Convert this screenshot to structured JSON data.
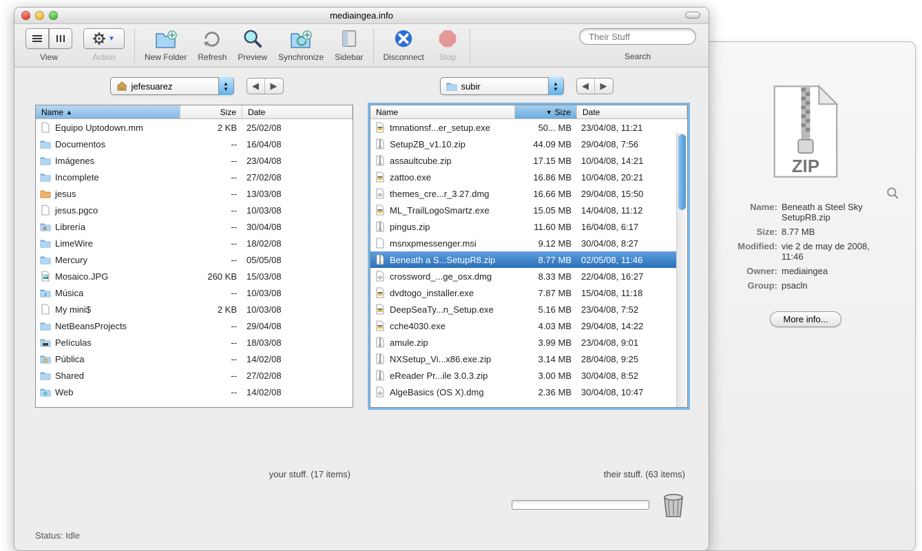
{
  "window": {
    "title": "mediaingea.info"
  },
  "toolbar": {
    "view_label": "View",
    "action_label": "Action",
    "new_folder": "New Folder",
    "refresh": "Refresh",
    "preview": "Preview",
    "synchronize": "Synchronize",
    "sidebar": "Sidebar",
    "disconnect": "Disconnect",
    "stop": "Stop",
    "search_label": "Search",
    "search_placeholder": "Their Stuff"
  },
  "path": {
    "left": "jefesuarez",
    "right": "subir"
  },
  "columns": {
    "name": "Name",
    "size": "Size",
    "date": "Date"
  },
  "left": {
    "label": "your stuff. (17 items)",
    "items": [
      {
        "icon": "doc",
        "name": "Equipo Uptodown.mm",
        "size": "2 KB",
        "date": "25/02/08"
      },
      {
        "icon": "folder",
        "name": "Documentos",
        "size": "--",
        "date": "16/04/08"
      },
      {
        "icon": "folder",
        "name": "Imágenes",
        "size": "--",
        "date": "23/04/08"
      },
      {
        "icon": "folder",
        "name": "Incomplete",
        "size": "--",
        "date": "27/02/08"
      },
      {
        "icon": "folder-orange",
        "name": "jesus",
        "size": "--",
        "date": "13/03/08"
      },
      {
        "icon": "doc",
        "name": "jesus.pgco",
        "size": "--",
        "date": "10/03/08"
      },
      {
        "icon": "folder-books",
        "name": "Librería",
        "size": "--",
        "date": "30/04/08"
      },
      {
        "icon": "folder",
        "name": "LimeWire",
        "size": "--",
        "date": "18/02/08"
      },
      {
        "icon": "folder",
        "name": "Mercury",
        "size": "--",
        "date": "05/05/08"
      },
      {
        "icon": "image",
        "name": "Mosaico.JPG",
        "size": "260 KB",
        "date": "15/03/08"
      },
      {
        "icon": "folder-music",
        "name": "Música",
        "size": "--",
        "date": "10/03/08"
      },
      {
        "icon": "doc",
        "name": "My mini$",
        "size": "2 KB",
        "date": "10/03/08"
      },
      {
        "icon": "folder",
        "name": "NetBeansProjects",
        "size": "--",
        "date": "29/04/08"
      },
      {
        "icon": "folder-movie",
        "name": "Películas",
        "size": "--",
        "date": "18/03/08"
      },
      {
        "icon": "folder-public",
        "name": "Pública",
        "size": "--",
        "date": "14/02/08"
      },
      {
        "icon": "folder",
        "name": "Shared",
        "size": "--",
        "date": "27/02/08"
      },
      {
        "icon": "folder-web",
        "name": "Web",
        "size": "--",
        "date": "14/02/08"
      }
    ]
  },
  "right": {
    "label": "their stuff. (63 items)",
    "selected_index": 8,
    "items": [
      {
        "icon": "exe",
        "name": "tmnationsf...er_setup.exe",
        "size": "50... MB",
        "date": "23/04/08, 11:21"
      },
      {
        "icon": "zip",
        "name": "SetupZB_v1.10.zip",
        "size": "44.09 MB",
        "date": "29/04/08, 7:56"
      },
      {
        "icon": "zip",
        "name": "assaultcube.zip",
        "size": "17.15 MB",
        "date": "10/04/08, 14:21"
      },
      {
        "icon": "exe",
        "name": "zattoo.exe",
        "size": "16.86 MB",
        "date": "10/04/08, 20:21"
      },
      {
        "icon": "dmg",
        "name": "themes_cre...r_3.27.dmg",
        "size": "16.66 MB",
        "date": "29/04/08, 15:50"
      },
      {
        "icon": "exe",
        "name": "ML_TrailLogoSmartz.exe",
        "size": "15.05 MB",
        "date": "14/04/08, 11:12"
      },
      {
        "icon": "zip",
        "name": "pingus.zip",
        "size": "11.60 MB",
        "date": "16/04/08, 6:17"
      },
      {
        "icon": "doc",
        "name": "msnxpmessenger.msi",
        "size": "9.12 MB",
        "date": "30/04/08, 8:27"
      },
      {
        "icon": "zip",
        "name": "Beneath a S...SetupR8.zip",
        "size": "8.77 MB",
        "date": "02/05/08, 11:46"
      },
      {
        "icon": "dmg",
        "name": "crossword_...ge_osx.dmg",
        "size": "8.33 MB",
        "date": "22/04/08, 16:27"
      },
      {
        "icon": "exe",
        "name": "dvdtogo_installer.exe",
        "size": "7.87 MB",
        "date": "15/04/08, 11:18"
      },
      {
        "icon": "exe",
        "name": "DeepSeaTy...n_Setup.exe",
        "size": "5.16 MB",
        "date": "23/04/08, 7:52"
      },
      {
        "icon": "exe",
        "name": "cche4030.exe",
        "size": "4.03 MB",
        "date": "29/04/08, 14:22"
      },
      {
        "icon": "zip",
        "name": "amule.zip",
        "size": "3.99 MB",
        "date": "23/04/08, 9:01"
      },
      {
        "icon": "zip",
        "name": "NXSetup_Vi...x86.exe.zip",
        "size": "3.14 MB",
        "date": "28/04/08, 9:25"
      },
      {
        "icon": "zip",
        "name": "eReader Pr...ile 3.0.3.zip",
        "size": "3.00 MB",
        "date": "30/04/08, 8:52"
      },
      {
        "icon": "dmg",
        "name": "AlgeBasics (OS X).dmg",
        "size": "2.36 MB",
        "date": "30/04/08, 10:47"
      }
    ]
  },
  "info": {
    "icon_label": "ZIP",
    "name_label": "Name:",
    "name": "Beneath a Steel Sky SetupR8.zip",
    "size_label": "Size:",
    "size": "8.77 MB",
    "modified_label": "Modified:",
    "modified": "vie 2 de may de 2008, 11:46",
    "owner_label": "Owner:",
    "owner": "mediaingea",
    "group_label": "Group:",
    "group": "psacln",
    "more_info": "More info..."
  },
  "status": {
    "label": "Status:",
    "value": "Idle"
  }
}
